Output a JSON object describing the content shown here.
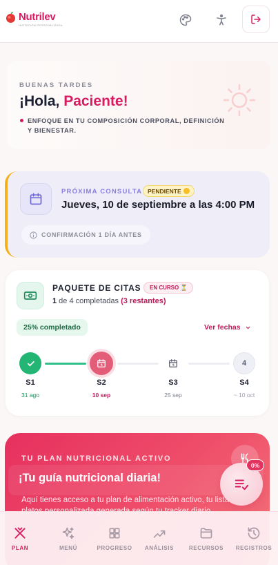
{
  "header": {
    "logo_text": "Nutrilev",
    "logo_sub": "NUTRICIÓN PERSONALIZADA"
  },
  "greeting": {
    "eyebrow": "BUENAS TARDES",
    "hello": "¡Hola,",
    "name": "Paciente!",
    "focus": "ENFOQUE EN TU COMPOSICIÓN CORPORAL, DEFINICIÓN Y BIENESTAR."
  },
  "appointment": {
    "label": "PRÓXIMA CONSULTA",
    "status": "PENDIENTE",
    "date": "Jueves, 10 de septiembre a las 4:00 PM",
    "confirm": "CONFIRMACIÓN 1 DÍA ANTES"
  },
  "package": {
    "title": "PAQUETE DE CITAS",
    "status": "EN CURSO ⏳",
    "done_count": "1",
    "of_text": " de 4 completadas ",
    "remaining": "(3 restantes)",
    "progress_percent": 25,
    "progress_label": "25% completado",
    "view_dates": "Ver fechas",
    "steps": [
      {
        "name": "S1",
        "date": "31 ago",
        "state": "done"
      },
      {
        "name": "S2",
        "date": "10 sep",
        "state": "current"
      },
      {
        "name": "S3",
        "date": "25 sep",
        "state": "upcoming"
      },
      {
        "name": "S4",
        "date": "~ 10 oct",
        "state": "pending",
        "number": "4"
      }
    ]
  },
  "plan": {
    "eyebrow": "TU PLAN NUTRICIONAL ACTIVO",
    "title": "¡Tu guía nutricional diaria!",
    "desc": "Aquí tienes acceso a tu plan de alimentación activo, tu lista de platos personalizada generada según tu tracker diario.",
    "fab_badge": "0%"
  },
  "nav": {
    "items": [
      {
        "label": "PLAN",
        "icon": "utensils-icon"
      },
      {
        "label": "MENÚ",
        "icon": "sparkles-icon"
      },
      {
        "label": "PROGRESO",
        "icon": "grid-icon"
      },
      {
        "label": "ANÁLISIS",
        "icon": "trend-icon"
      },
      {
        "label": "RECURSOS",
        "icon": "folder-icon"
      },
      {
        "label": "REGISTROS",
        "icon": "history-icon"
      }
    ]
  },
  "colors": {
    "brand": "#d81b60",
    "success": "#22b573",
    "pending": "#f3b11e"
  }
}
